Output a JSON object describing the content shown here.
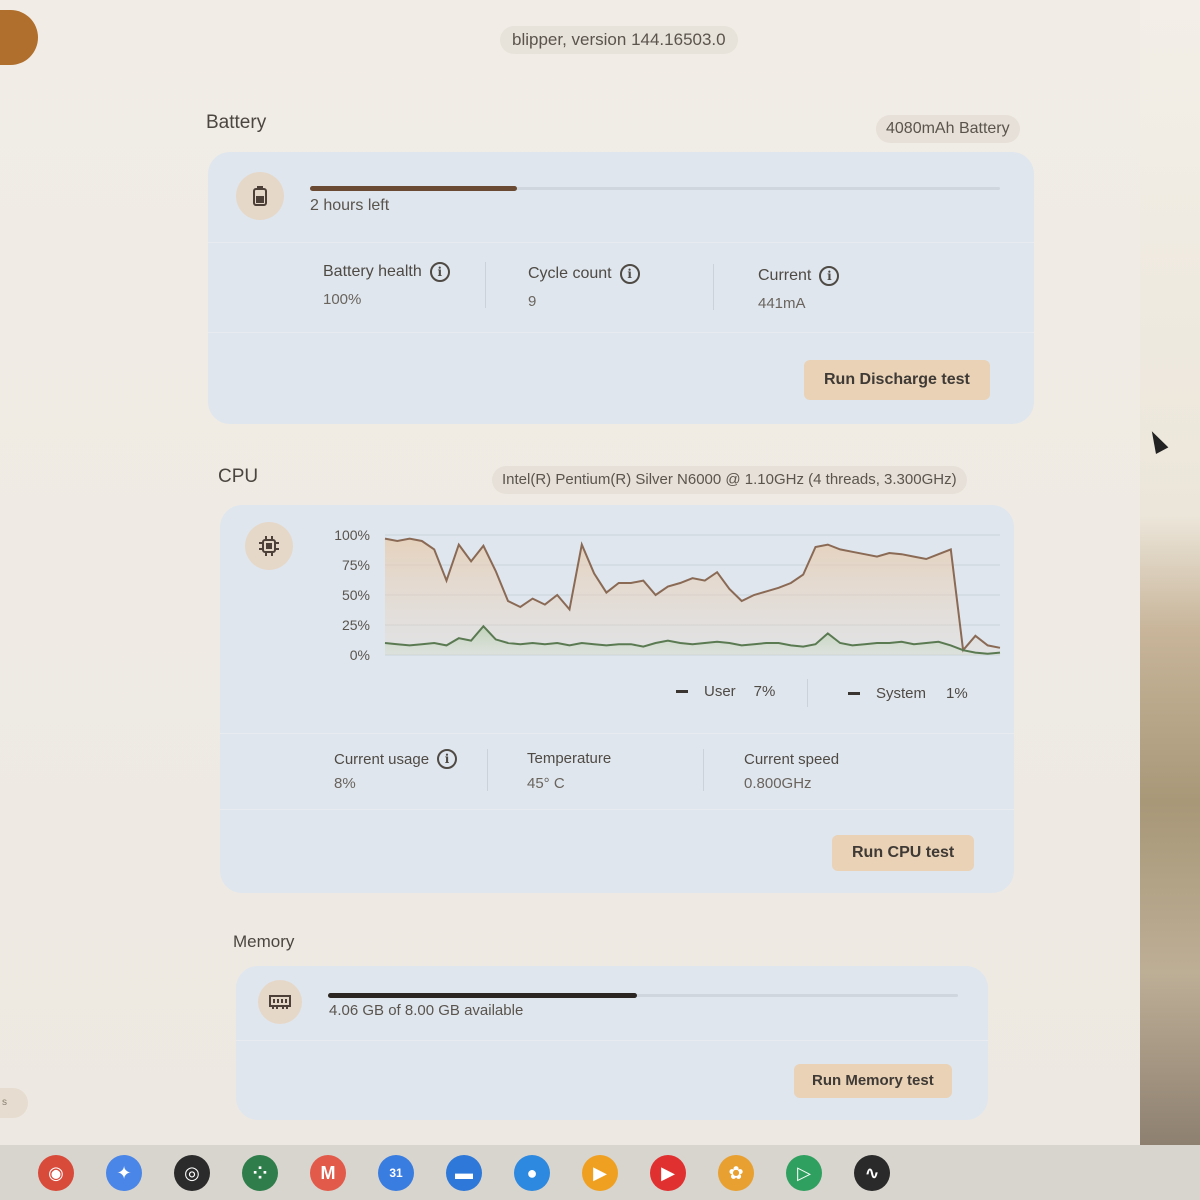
{
  "app": {
    "version": "blipper, version 144.16503.0"
  },
  "battery": {
    "title": "Battery",
    "capacity_chip": "4080mAh Battery",
    "time_left": "2 hours left",
    "charge_fraction": 0.3,
    "stats": [
      {
        "label": "Battery health",
        "value": "100%"
      },
      {
        "label": "Cycle count",
        "value": "9"
      },
      {
        "label": "Current",
        "value": "441mA"
      }
    ],
    "button_label": "Run Discharge test"
  },
  "cpu": {
    "title": "CPU",
    "model_chip": "Intel(R) Pentium(R) Silver N6000 @ 1.10GHz (4 threads, 3.300GHz)",
    "legend": [
      {
        "label": "User",
        "value": "7%"
      },
      {
        "label": "System",
        "value": "1%"
      }
    ],
    "stats": [
      {
        "label": "Current usage",
        "value": "8%"
      },
      {
        "label": "Temperature",
        "value": "45° C"
      },
      {
        "label": "Current speed",
        "value": "0.800GHz"
      }
    ],
    "button_label": "Run CPU test"
  },
  "memory": {
    "title": "Memory",
    "available_text": "4.06 GB of 8.00 GB available",
    "used_fraction": 0.49,
    "button_label": "Run Memory test"
  },
  "chart_data": {
    "type": "area",
    "ylim": [
      0,
      100
    ],
    "y_ticks": [
      "100%",
      "75%",
      "50%",
      "25%",
      "0%"
    ],
    "grid": true,
    "legend_position": "bottom-right",
    "series": [
      {
        "name": "User",
        "color": "#8a6a55",
        "values": [
          97,
          95,
          97,
          95,
          88,
          62,
          92,
          78,
          91,
          70,
          45,
          40,
          47,
          42,
          50,
          38,
          92,
          68,
          52,
          60,
          60,
          62,
          50,
          57,
          60,
          64,
          62,
          69,
          55,
          45,
          50,
          53,
          56,
          60,
          67,
          90,
          92,
          88,
          86,
          84,
          82,
          85,
          84,
          82,
          80,
          84,
          88,
          4,
          16,
          8,
          6
        ]
      },
      {
        "name": "System",
        "color": "#5a7a52",
        "values": [
          10,
          9,
          8,
          9,
          10,
          8,
          14,
          12,
          24,
          13,
          10,
          9,
          10,
          9,
          10,
          8,
          10,
          9,
          8,
          9,
          9,
          7,
          10,
          12,
          10,
          9,
          10,
          11,
          10,
          8,
          9,
          10,
          10,
          8,
          7,
          9,
          18,
          10,
          8,
          9,
          10,
          10,
          11,
          9,
          10,
          11,
          8,
          4,
          2,
          1,
          2
        ]
      }
    ]
  },
  "taskbar": {
    "apps": [
      {
        "icon": "chrome-icon",
        "color": "#d84a3a"
      },
      {
        "icon": "assistant-icon",
        "color": "#4a86e8"
      },
      {
        "icon": "cast-icon",
        "color": "#2b2b2b"
      },
      {
        "icon": "launcher-icon",
        "color": "#2f7d4a"
      },
      {
        "icon": "gmail-icon",
        "color": "#e25a4a"
      },
      {
        "icon": "calendar-icon",
        "color": "#3a7de0"
      },
      {
        "icon": "files-icon",
        "color": "#2d78d8"
      },
      {
        "icon": "chat-icon",
        "color": "#2d88e0"
      },
      {
        "icon": "meet-icon",
        "color": "#f0a020"
      },
      {
        "icon": "youtube-icon",
        "color": "#e03030"
      },
      {
        "icon": "photos-icon",
        "color": "#e8a030"
      },
      {
        "icon": "play-store-icon",
        "color": "#30a060"
      },
      {
        "icon": "diagnostics-icon",
        "color": "#2a2a2a"
      }
    ]
  }
}
